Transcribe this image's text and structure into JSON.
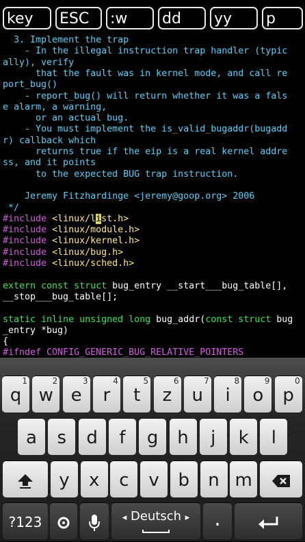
{
  "toolbar": {
    "buttons": [
      "key",
      "ESC",
      ":w",
      "dd",
      "yy",
      "p"
    ]
  },
  "editor": {
    "lines": [
      {
        "segments": [
          {
            "t": "  3. Implement the trap",
            "c": "comment"
          }
        ]
      },
      {
        "segments": [
          {
            "t": "    - In the illegal instruction trap handler (typic",
            "c": "comment"
          }
        ]
      },
      {
        "segments": [
          {
            "t": "ally), verify",
            "c": "comment"
          }
        ]
      },
      {
        "segments": [
          {
            "t": "      that the fault was in kernel mode, and call re",
            "c": "comment"
          }
        ]
      },
      {
        "segments": [
          {
            "t": "port_bug()",
            "c": "comment"
          }
        ]
      },
      {
        "segments": [
          {
            "t": "    - report_bug() will return whether it was a fals",
            "c": "comment"
          }
        ]
      },
      {
        "segments": [
          {
            "t": "e alarm, a warning,",
            "c": "comment"
          }
        ]
      },
      {
        "segments": [
          {
            "t": "      or an actual bug.",
            "c": "comment"
          }
        ]
      },
      {
        "segments": [
          {
            "t": "    - You must implement the is_valid_bugaddr(bugadd",
            "c": "comment"
          }
        ]
      },
      {
        "segments": [
          {
            "t": "r) callback which",
            "c": "comment"
          }
        ]
      },
      {
        "segments": [
          {
            "t": "      returns true if the eip is a real kernel addre",
            "c": "comment"
          }
        ]
      },
      {
        "segments": [
          {
            "t": "ss, and it points",
            "c": "comment"
          }
        ]
      },
      {
        "segments": [
          {
            "t": "      to the expected BUG trap instruction.",
            "c": "comment"
          }
        ]
      },
      {
        "segments": [
          {
            "t": "",
            "c": "comment"
          }
        ]
      },
      {
        "segments": [
          {
            "t": "    Jeremy Fitzhardinge <jeremy@goop.org> 2006",
            "c": "comment"
          }
        ]
      },
      {
        "segments": [
          {
            "t": " */",
            "c": "comment"
          }
        ]
      },
      {
        "segments": [
          {
            "t": "#include ",
            "c": "pre"
          },
          {
            "t": "<linux/l",
            "c": "inc"
          },
          {
            "t": "i",
            "c": "cursor"
          },
          {
            "t": "st.h>",
            "c": "inc"
          }
        ]
      },
      {
        "segments": [
          {
            "t": "#include ",
            "c": "pre"
          },
          {
            "t": "<linux/module.h>",
            "c": "inc"
          }
        ]
      },
      {
        "segments": [
          {
            "t": "#include ",
            "c": "pre"
          },
          {
            "t": "<linux/kernel.h>",
            "c": "inc"
          }
        ]
      },
      {
        "segments": [
          {
            "t": "#include ",
            "c": "pre"
          },
          {
            "t": "<linux/bug.h>",
            "c": "inc"
          }
        ]
      },
      {
        "segments": [
          {
            "t": "#include ",
            "c": "pre"
          },
          {
            "t": "<linux/sched.h>",
            "c": "inc"
          }
        ]
      },
      {
        "segments": [
          {
            "t": "",
            "c": "id"
          }
        ]
      },
      {
        "segments": [
          {
            "t": "extern const struct ",
            "c": "kw"
          },
          {
            "t": "bug_entry __start___bug_table[],",
            "c": "id"
          }
        ]
      },
      {
        "segments": [
          {
            "t": "__stop___bug_table[];",
            "c": "id"
          }
        ]
      },
      {
        "segments": [
          {
            "t": "",
            "c": "id"
          }
        ]
      },
      {
        "segments": [
          {
            "t": "static inline unsigned long ",
            "c": "kw"
          },
          {
            "t": "bug_addr(",
            "c": "id"
          },
          {
            "t": "const struct ",
            "c": "kw"
          },
          {
            "t": "bug",
            "c": "id"
          }
        ]
      },
      {
        "segments": [
          {
            "t": "_entry *bug)",
            "c": "id"
          }
        ]
      },
      {
        "segments": [
          {
            "t": "{",
            "c": "id"
          }
        ]
      },
      {
        "segments": [
          {
            "t": "#ifndef CONFIG_GENERIC_BUG_RELATIVE_POINTERS",
            "c": "pre"
          }
        ]
      }
    ]
  },
  "keyboard": {
    "row1": [
      {
        "label": "q",
        "hint": "1"
      },
      {
        "label": "w",
        "hint": "2"
      },
      {
        "label": "e",
        "hint": "3"
      },
      {
        "label": "r",
        "hint": "4"
      },
      {
        "label": "t",
        "hint": "5"
      },
      {
        "label": "z",
        "hint": "6"
      },
      {
        "label": "u",
        "hint": "7"
      },
      {
        "label": "i",
        "hint": "8"
      },
      {
        "label": "o",
        "hint": "9"
      },
      {
        "label": "p",
        "hint": "0"
      }
    ],
    "row2": [
      "a",
      "s",
      "d",
      "f",
      "g",
      "h",
      "j",
      "k",
      "l"
    ],
    "row3": [
      "y",
      "x",
      "c",
      "v",
      "b",
      "n",
      "m"
    ],
    "symbols_label": "?123",
    "language_label": "Deutsch",
    "space_indicator_left": "◂",
    "space_indicator_right": "▸",
    "dot_label": ".",
    "icons": [
      "shift-icon",
      "backspace-icon",
      "settings-icon",
      "microphone-icon",
      "enter-icon"
    ]
  },
  "colors": {
    "comment": "#57d0f6",
    "preprocessor": "#d35be0",
    "include_path": "#ffe97a",
    "keyword": "#35e35e",
    "identifier": "#ffffff",
    "cursor": "#d9d36a"
  }
}
